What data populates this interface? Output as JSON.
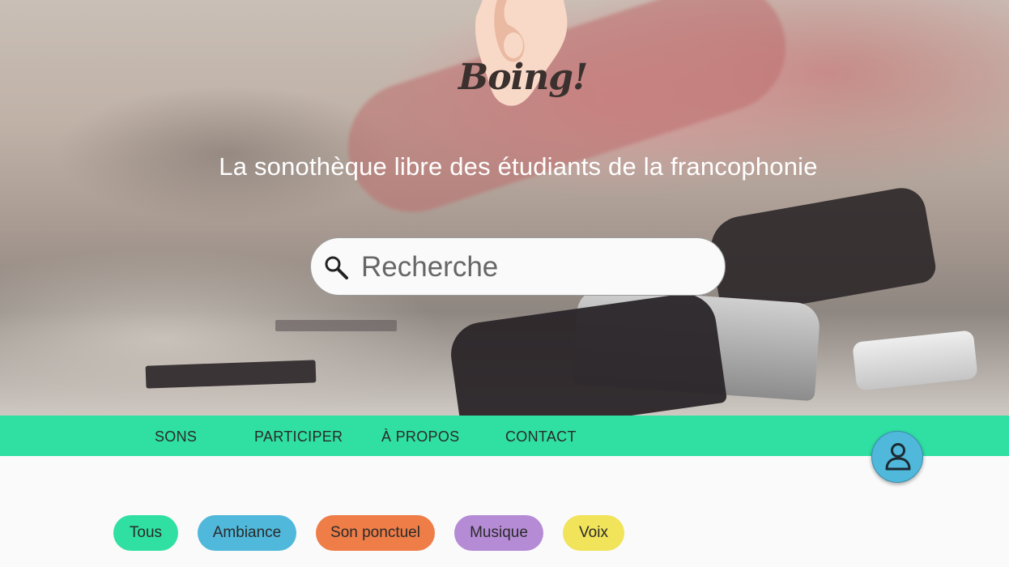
{
  "brand": {
    "logo_text": "Boing!"
  },
  "hero": {
    "tagline": "La sonothèque libre des étudiants de la francophonie"
  },
  "search": {
    "placeholder": "Recherche",
    "value": ""
  },
  "nav": {
    "items": [
      {
        "label": "SONS"
      },
      {
        "label": "PARTICIPER"
      },
      {
        "label": "À PROPOS"
      },
      {
        "label": "CONTACT"
      }
    ]
  },
  "filters": {
    "chips": [
      {
        "label": "Tous",
        "color": "#2fe0a2"
      },
      {
        "label": "Ambiance",
        "color": "#50b8da"
      },
      {
        "label": "Son ponctuel",
        "color": "#ee7d48"
      },
      {
        "label": "Musique",
        "color": "#b58bd6"
      },
      {
        "label": "Voix",
        "color": "#f1e35a"
      }
    ]
  },
  "fab": {
    "icon": "user-icon"
  },
  "colors": {
    "accent": "#2fe0a2",
    "fab": "#50b8da"
  }
}
